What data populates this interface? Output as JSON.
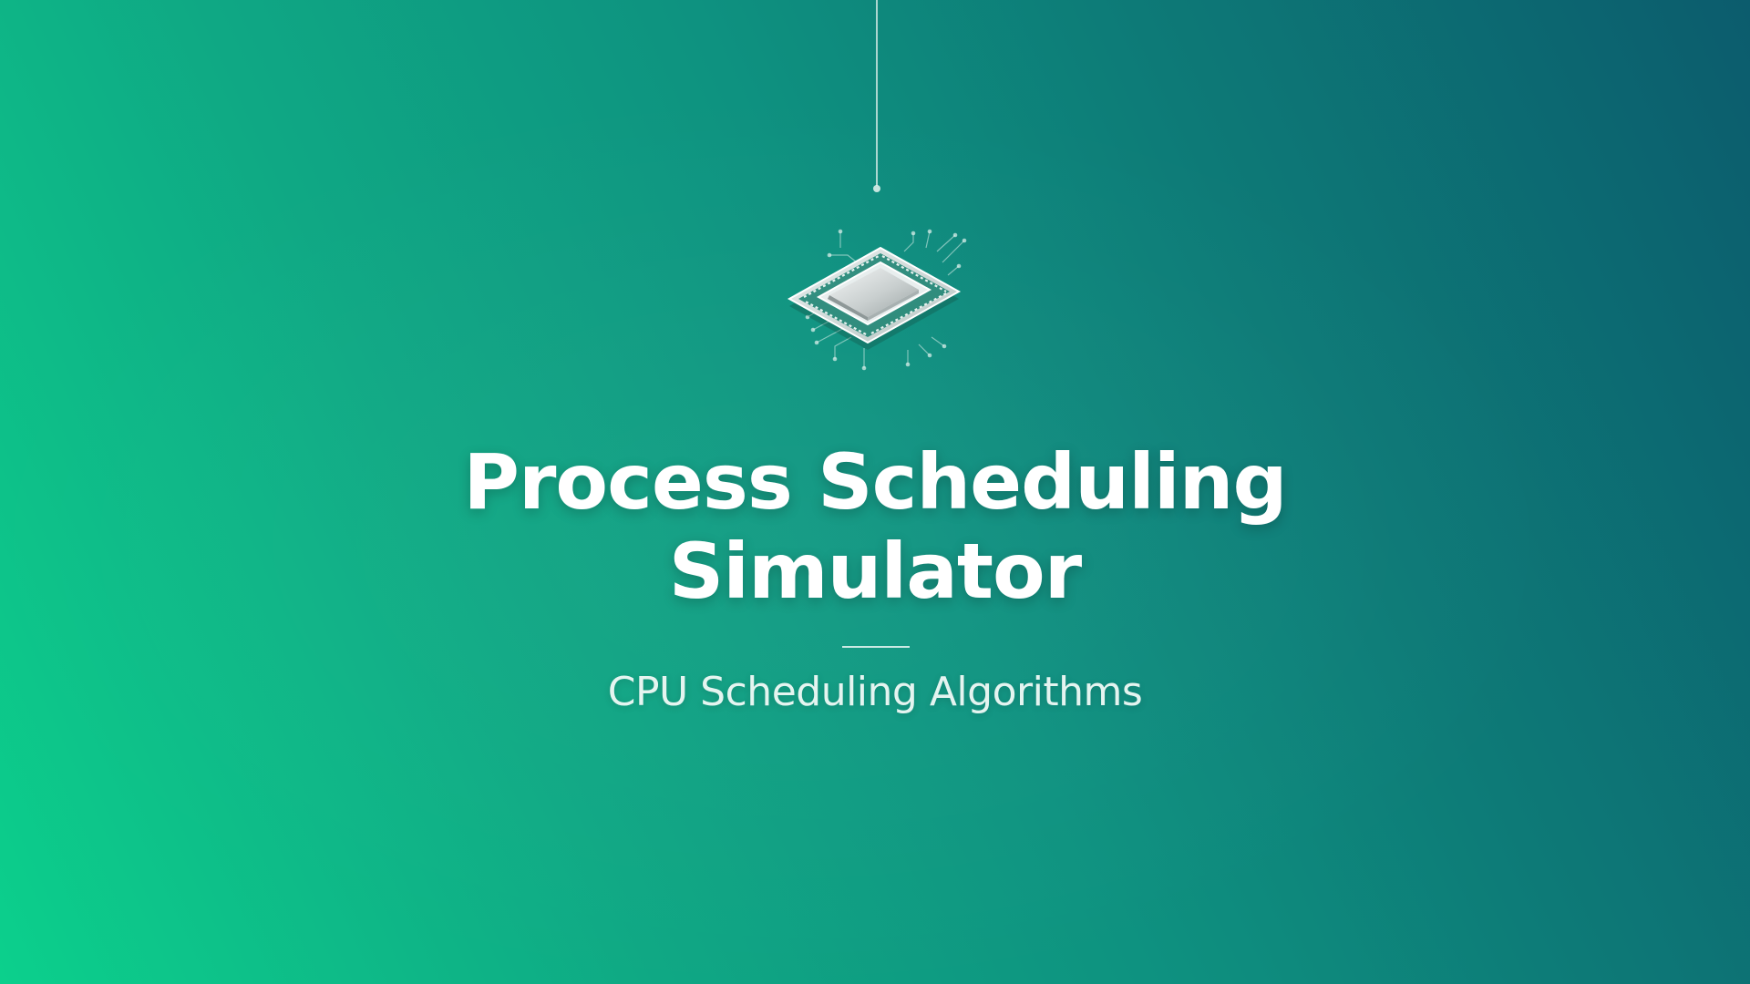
{
  "slide": {
    "title_line1": "Process Scheduling",
    "title_line2": "Simulator",
    "subtitle": "CPU Scheduling Algorithms",
    "icon": "cpu-chip-icon"
  },
  "colors": {
    "gradient_start": "#0cd08c",
    "gradient_end": "#0c5c6d",
    "text": "#ffffff"
  }
}
